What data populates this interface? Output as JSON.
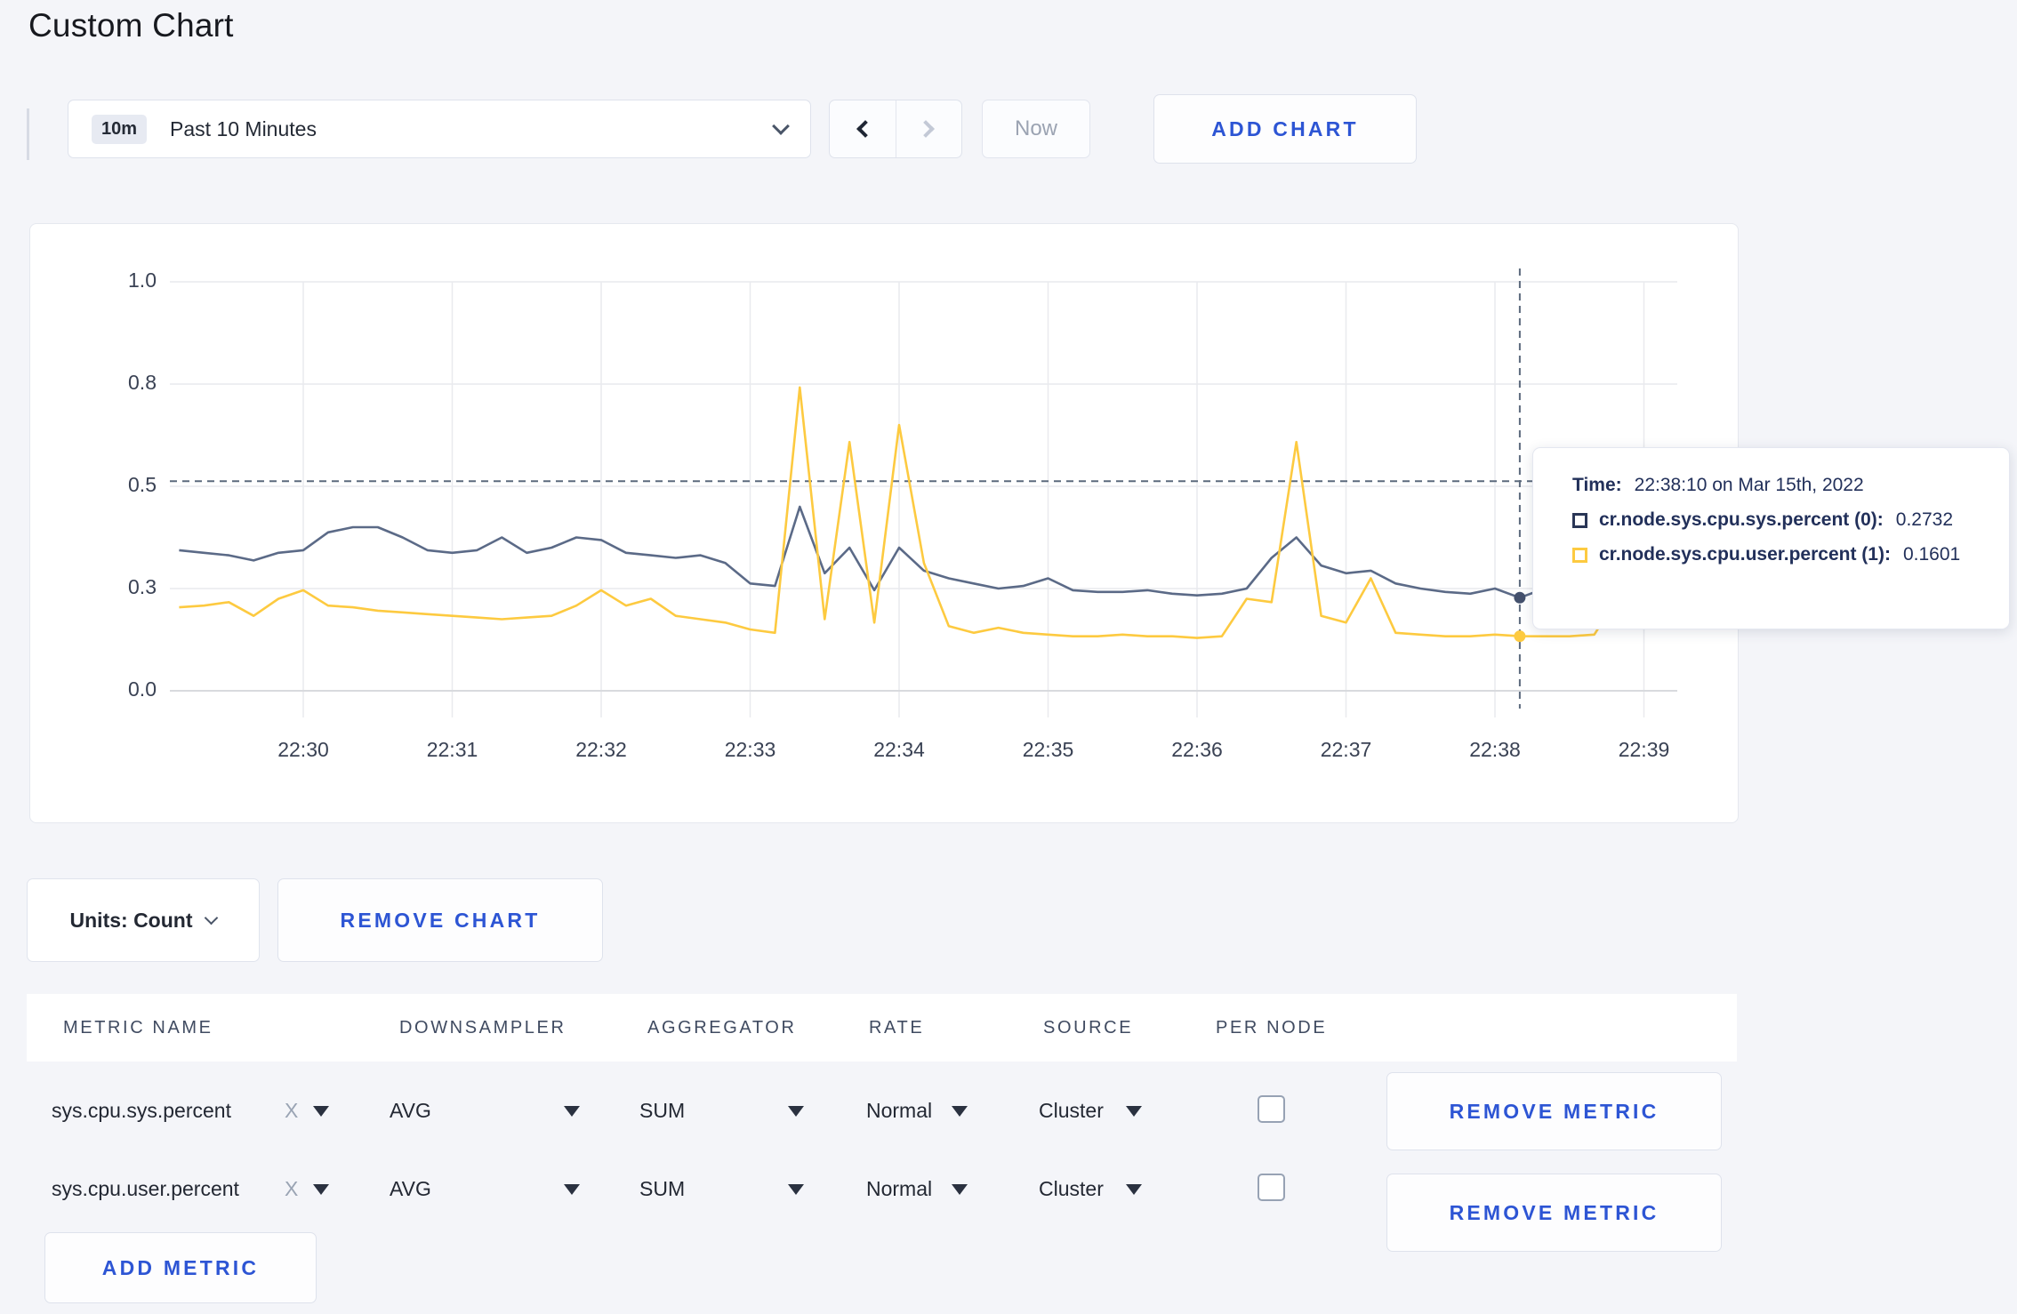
{
  "page": {
    "title": "Custom Chart",
    "background_color": "#f4f5f9"
  },
  "toolbar": {
    "time_range": {
      "badge": "10m",
      "label": "Past 10 Minutes"
    },
    "prev_button_enabled": true,
    "next_button_enabled": false,
    "now_label": "Now",
    "add_chart_label": "ADD CHART"
  },
  "chart_data": {
    "type": "line",
    "title": "",
    "xlabel": "",
    "ylabel": "",
    "x_tick_labels": [
      "22:30",
      "22:31",
      "22:32",
      "22:33",
      "22:34",
      "22:35",
      "22:36",
      "22:37",
      "22:38",
      "22:39"
    ],
    "y_tick_labels": [
      "0.0",
      "0.3",
      "0.5",
      "0.8",
      "1.0"
    ],
    "y_tick_values": [
      0,
      0.3,
      0.5,
      0.8,
      1.0
    ],
    "y_axis_nonlinear_even_tick_spacing": true,
    "ylim": [
      0,
      1.0
    ],
    "grid": true,
    "start_offset_seconds": -50,
    "interval_seconds": 10,
    "series": [
      {
        "name": "cr.node.sys.cpu.sys.percent",
        "color": "#5b6a87",
        "values": [
          0.375,
          0.37,
          0.365,
          0.355,
          0.37,
          0.375,
          0.41,
          0.42,
          0.42,
          0.4,
          0.375,
          0.37,
          0.375,
          0.4,
          0.37,
          0.38,
          0.4,
          0.395,
          0.37,
          0.365,
          0.36,
          0.365,
          0.35,
          0.31,
          0.305,
          0.46,
          0.33,
          0.38,
          0.295,
          0.38,
          0.335,
          0.32,
          0.31,
          0.3,
          0.305,
          0.32,
          0.295,
          0.29,
          0.29,
          0.295,
          0.285,
          0.28,
          0.285,
          0.3,
          0.36,
          0.4,
          0.345,
          0.33,
          0.335,
          0.31,
          0.3,
          0.29,
          0.285,
          0.3,
          0.2732,
          0.3,
          0.31,
          0.3,
          0.295,
          0.3,
          0.305
        ]
      },
      {
        "name": "cr.node.sys.cpu.user.percent",
        "color": "#fdca40",
        "values": [
          0.245,
          0.25,
          0.26,
          0.22,
          0.27,
          0.295,
          0.25,
          0.245,
          0.235,
          0.23,
          0.225,
          0.22,
          0.215,
          0.21,
          0.215,
          0.22,
          0.25,
          0.295,
          0.25,
          0.27,
          0.22,
          0.21,
          0.2,
          0.18,
          0.17,
          0.79,
          0.21,
          0.63,
          0.2,
          0.68,
          0.35,
          0.19,
          0.17,
          0.185,
          0.17,
          0.165,
          0.16,
          0.16,
          0.165,
          0.16,
          0.16,
          0.155,
          0.16,
          0.27,
          0.26,
          0.63,
          0.22,
          0.2,
          0.32,
          0.17,
          0.165,
          0.16,
          0.16,
          0.165,
          0.1601,
          0.16,
          0.16,
          0.165,
          0.28,
          0.27,
          0.235
        ]
      }
    ],
    "crosshair": {
      "time_offset_seconds": 490,
      "time_label": "22:38:10",
      "hline_value": 0.515,
      "point_values": [
        0.2732,
        0.1601
      ],
      "point_colors": [
        "#44516d",
        "#fdca40"
      ]
    }
  },
  "tooltip": {
    "time_label": "Time:",
    "time_value": "22:38:10 on Mar 15th, 2022",
    "rows": [
      {
        "name": "cr.node.sys.cpu.sys.percent (0):",
        "value": "0.2732",
        "color": "#2a3656"
      },
      {
        "name": "cr.node.sys.cpu.user.percent (1):",
        "value": "0.1601",
        "color": "#fdca40"
      }
    ]
  },
  "chart_controls": {
    "units_label": "Units: Count",
    "remove_chart_label": "REMOVE CHART"
  },
  "metrics_table": {
    "headers": [
      "METRIC NAME",
      "DOWNSAMPLER",
      "AGGREGATOR",
      "RATE",
      "SOURCE",
      "PER NODE"
    ],
    "rows": [
      {
        "metric": "sys.cpu.sys.percent",
        "remove_glyph": "X",
        "downsampler": "AVG",
        "aggregator": "SUM",
        "rate": "Normal",
        "source": "Cluster",
        "per_node_checked": false,
        "remove_label": "REMOVE METRIC"
      },
      {
        "metric": "sys.cpu.user.percent",
        "remove_glyph": "X",
        "downsampler": "AVG",
        "aggregator": "SUM",
        "rate": "Normal",
        "source": "Cluster",
        "per_node_checked": false,
        "remove_label": "REMOVE METRIC"
      }
    ],
    "add_metric_label": "ADD METRIC"
  },
  "colors": {
    "accent_blue": "#2d55d4",
    "series_sys": "#5b6a87",
    "series_user": "#fdca40"
  }
}
